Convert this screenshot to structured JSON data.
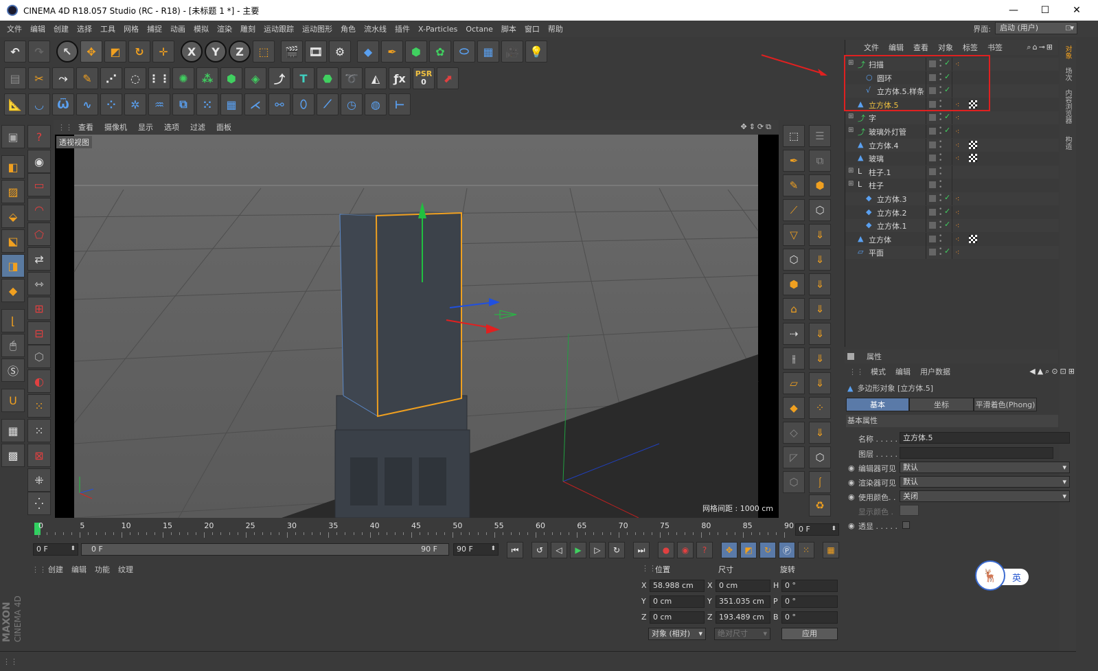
{
  "window": {
    "title": "CINEMA 4D R18.057 Studio (RC - R18) - [未标题 1 *] - 主要",
    "minimize": "—",
    "maximize": "☐",
    "close": "✕"
  },
  "menubar": {
    "items": [
      "文件",
      "编辑",
      "创建",
      "选择",
      "工具",
      "网格",
      "捕捉",
      "动画",
      "模拟",
      "渲染",
      "雕刻",
      "运动跟踪",
      "运动图形",
      "角色",
      "流水线",
      "插件",
      "X-Particles",
      "Octane",
      "脚本",
      "窗口",
      "帮助"
    ],
    "layout_label": "界面:",
    "layout_value": "启动 (用户)"
  },
  "toolbar": {
    "axis_x": "X",
    "axis_y": "Y",
    "axis_z": "Z",
    "psr": "PSR",
    "psr_value": "0",
    "text_tool": "T"
  },
  "viewport": {
    "menu": [
      "查看",
      "摄像机",
      "显示",
      "选项",
      "过滤",
      "面板"
    ],
    "label": "透视视图",
    "grid_spacing": "网格间距 : 1000 cm"
  },
  "object_manager": {
    "menu": [
      "文件",
      "编辑",
      "查看",
      "对象",
      "标签",
      "书签"
    ],
    "objects": [
      {
        "name": "扫描",
        "icon": "sweep-icon",
        "visible_check": true,
        "tags": [
          "phong"
        ]
      },
      {
        "name": "圆环",
        "icon": "circle-spline-icon",
        "visible_check": true,
        "tags": []
      },
      {
        "name": "立方体.5.样条",
        "icon": "spline-icon",
        "visible_check": true,
        "tags": []
      },
      {
        "name": "立方体.5",
        "icon": "polygon-icon",
        "visible_check": false,
        "tags": [
          "phong",
          "texture"
        ],
        "selected": true
      },
      {
        "name": "字",
        "icon": "sweep-icon",
        "visible_check": true,
        "tags": [
          "phong"
        ]
      },
      {
        "name": "玻璃外灯管",
        "icon": "sweep-icon",
        "visible_check": true,
        "tags": [
          "phong"
        ]
      },
      {
        "name": "立方体.4",
        "icon": "polygon-icon",
        "visible_check": false,
        "tags": [
          "phong",
          "texture"
        ]
      },
      {
        "name": "玻璃",
        "icon": "polygon-icon",
        "visible_check": false,
        "tags": [
          "phong",
          "texture"
        ]
      },
      {
        "name": "柱子.1",
        "icon": "null-icon",
        "visible_check": false,
        "tags": []
      },
      {
        "name": "柱子",
        "icon": "null-icon",
        "visible_check": false,
        "tags": []
      },
      {
        "name": "立方体.3",
        "icon": "cube-icon",
        "visible_check": true,
        "tags": [
          "phong"
        ]
      },
      {
        "name": "立方体.2",
        "icon": "cube-icon",
        "visible_check": true,
        "tags": [
          "phong"
        ]
      },
      {
        "name": "立方体.1",
        "icon": "cube-icon",
        "visible_check": true,
        "tags": [
          "phong"
        ]
      },
      {
        "name": "立方体",
        "icon": "polygon-icon",
        "visible_check": false,
        "tags": [
          "phong",
          "texture"
        ]
      },
      {
        "name": "平面",
        "icon": "plane-icon",
        "visible_check": true,
        "tags": [
          "phong"
        ]
      }
    ]
  },
  "side_tabs": [
    "对象",
    "场次",
    "内容浏览器",
    "构造"
  ],
  "attributes": {
    "title": "属性",
    "menu": [
      "模式",
      "编辑",
      "用户数据"
    ],
    "object_type": "多边形对象 [立方体.5]",
    "tabs": [
      "基本",
      "坐标",
      "平滑着色(Phong)"
    ],
    "section": "基本属性",
    "name_label": "名称 . . . . .",
    "name_value": "立方体.5",
    "layer_label": "图层 . . . . .",
    "layer_value": "",
    "editor_visible_label": "编辑器可见",
    "editor_visible_value": "默认",
    "render_visible_label": "渲染器可见",
    "render_visible_value": "默认",
    "use_color_label": "使用颜色. .",
    "use_color_value": "关闭",
    "display_color_label": "显示颜色 .",
    "xray_label": "透显 . . . . ."
  },
  "timeline": {
    "ticks": [
      "0",
      "5",
      "10",
      "15",
      "20",
      "25",
      "30",
      "35",
      "40",
      "45",
      "50",
      "55",
      "60",
      "65",
      "70",
      "75",
      "80",
      "85",
      "90"
    ],
    "current_frame": "0 F"
  },
  "transport": {
    "start_frame": "0 F",
    "range_start": "0 F",
    "range_end": "90 F",
    "end_frame": "90 F"
  },
  "material_manager": {
    "menu": [
      "创建",
      "编辑",
      "功能",
      "纹理"
    ]
  },
  "coordinates": {
    "headers": [
      "位置",
      "尺寸",
      "旋转"
    ],
    "rows": [
      {
        "axis": "X",
        "pos": "58.988 cm",
        "size_axis": "X",
        "size": "0 cm",
        "rot_axis": "H",
        "rot": "0 °"
      },
      {
        "axis": "Y",
        "pos": "0 cm",
        "size_axis": "Y",
        "size": "351.035 cm",
        "rot_axis": "P",
        "rot": "0 °"
      },
      {
        "axis": "Z",
        "pos": "0 cm",
        "size_axis": "Z",
        "size": "193.489 cm",
        "rot_axis": "B",
        "rot": "0 °"
      }
    ],
    "mode": "对象 (相对)",
    "size_mode": "绝对尺寸",
    "apply": "应用"
  },
  "branding": {
    "maxon": "MAXON",
    "c4d": "CINEMA 4D"
  },
  "ime": {
    "lang": "英"
  },
  "colors": {
    "selected_text": "#f0c040",
    "annotation_red": "#e02020",
    "selection_orange": "#f0a020"
  }
}
